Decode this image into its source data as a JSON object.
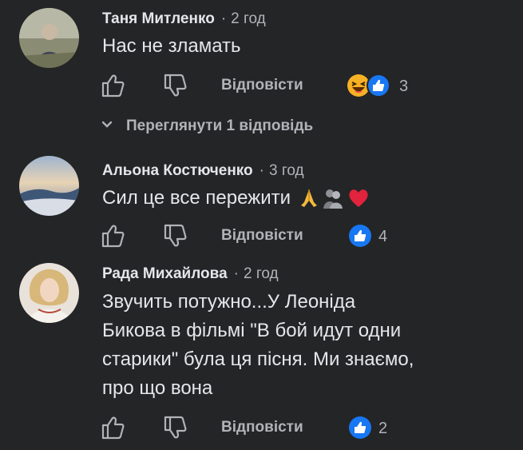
{
  "colors": {
    "background": "#242526",
    "text_primary": "#e4e6eb",
    "text_secondary": "#b0b3b8",
    "like_blue": "#1877f2",
    "heart_red": "#f33e58"
  },
  "comments": [
    {
      "author": "Таня Митленко",
      "separator": "·",
      "time": "2 год",
      "text": "Нас не зламать",
      "like_icon": "thumbs-up-icon",
      "dislike_icon": "thumbs-down-icon",
      "reply_label": "Відповісти",
      "reactions": [
        "haha-icon",
        "like-icon"
      ],
      "reaction_count": "3",
      "view_replies": "Переглянути 1 відповідь"
    },
    {
      "author": "Альона Костюченко",
      "separator": "·",
      "time": "3 год",
      "text": "Сил це все пережити",
      "text_emojis": [
        "folded-hands-emoji",
        "hugging-people-emoji",
        "red-heart-emoji"
      ],
      "like_icon": "thumbs-up-icon",
      "dislike_icon": "thumbs-down-icon",
      "reply_label": "Відповісти",
      "reactions": [
        "like-icon"
      ],
      "reaction_count": "4"
    },
    {
      "author": "Рада Михайлова",
      "separator": "·",
      "time": "2 год",
      "text_lines": [
        "Звучить потужно...У Леоніда",
        "Бикова в фільмі \"В бой идут одни",
        "старики\" була ця пісня. Ми знаємо,",
        "про що вона"
      ],
      "like_icon": "thumbs-up-icon",
      "dislike_icon": "thumbs-down-icon",
      "reply_label": "Відповісти",
      "reactions": [
        "like-icon"
      ],
      "reaction_count": "2"
    }
  ]
}
